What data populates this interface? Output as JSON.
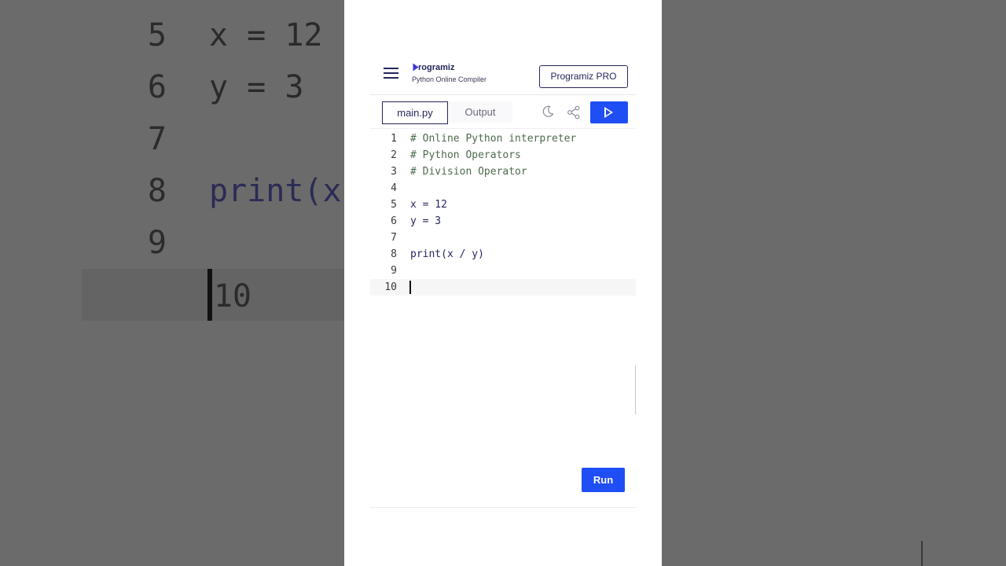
{
  "background_zoom": {
    "lines": [
      {
        "num": "5",
        "code": "x = 12"
      },
      {
        "num": "6",
        "code": "y = 3"
      },
      {
        "num": "7",
        "code": ""
      },
      {
        "num": "8",
        "code": "print(x"
      },
      {
        "num": "9",
        "code": ""
      },
      {
        "num": "10",
        "code": ""
      }
    ]
  },
  "header": {
    "logo_name": "rogramiz",
    "logo_subtitle": "Python Online Compiler",
    "pro_button": "Programiz PRO"
  },
  "toolbar": {
    "tabs": [
      {
        "label": "main.py",
        "active": true
      },
      {
        "label": "Output",
        "active": false
      }
    ],
    "icons": [
      "moon-icon",
      "share-icon",
      "play-icon"
    ]
  },
  "editor": {
    "active_line": 10,
    "lines": [
      {
        "num": "1",
        "code": "# Online Python interpreter"
      },
      {
        "num": "2",
        "code": "# Python Operators"
      },
      {
        "num": "3",
        "code": "# Division Operator"
      },
      {
        "num": "4",
        "code": ""
      },
      {
        "num": "5",
        "code": "x = 12"
      },
      {
        "num": "6",
        "code": "y = 3"
      },
      {
        "num": "7",
        "code": ""
      },
      {
        "num": "8",
        "code": "print(x / y)"
      },
      {
        "num": "9",
        "code": ""
      },
      {
        "num": "10",
        "code": ""
      }
    ]
  },
  "run_button": "Run",
  "colors": {
    "brand_navy": "#25265e",
    "run_blue": "#1f4ef5",
    "comment_green": "#4d6b4d"
  }
}
